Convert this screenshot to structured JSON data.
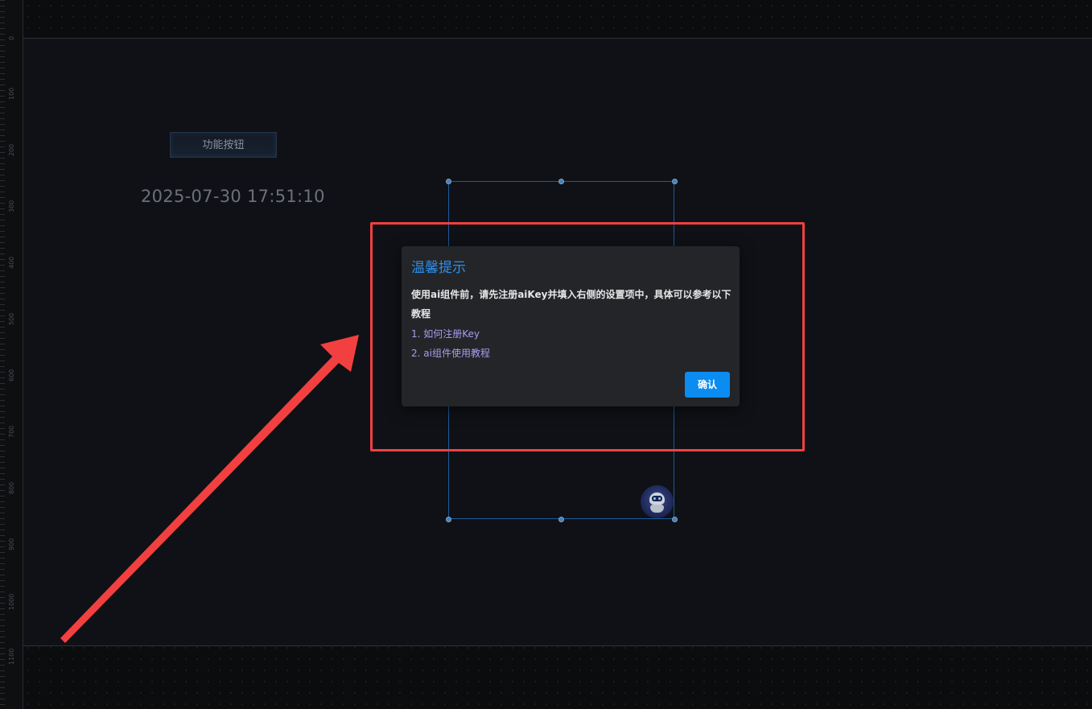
{
  "ruler": {
    "labels": [
      "0",
      "100",
      "200",
      "300",
      "400",
      "500",
      "600",
      "700",
      "800",
      "900",
      "1000",
      "1100"
    ]
  },
  "canvas": {
    "function_button_label": "功能按钮",
    "datetime": "2025-07-30 17:51:10"
  },
  "dialog": {
    "title": "温馨提示",
    "message": "使用ai组件前，请先注册aiKey并填入右侧的设置项中，具体可以参考以下教程",
    "links": [
      "1. 如何注册Key",
      "2. ai组件使用教程"
    ],
    "confirm_label": "确认"
  },
  "colors": {
    "highlight": "#f24040",
    "dialog_title": "#2e8fea",
    "link": "#a89cf0",
    "confirm_button": "#0b8cf0",
    "selection": "#1e5a99"
  },
  "icons": {
    "assistant": "robot-icon"
  }
}
